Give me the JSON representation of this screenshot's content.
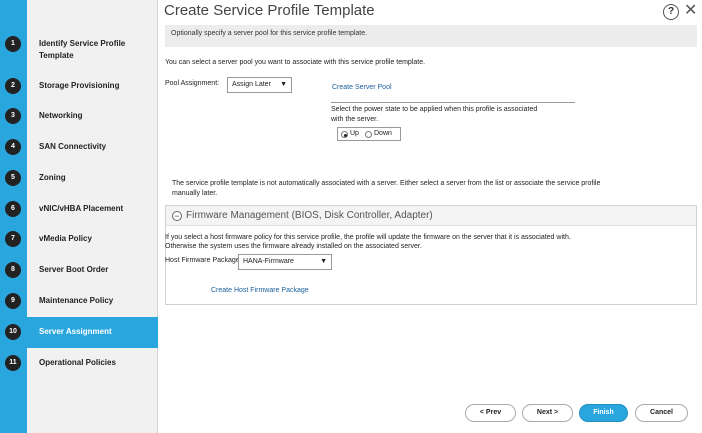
{
  "header": {
    "title": "Create Service Profile Template",
    "help_icon": "?",
    "close_icon": "✕"
  },
  "steps": [
    {
      "num": "1",
      "label": "Identify Service Profile",
      "label2": "Template",
      "active": false
    },
    {
      "num": "2",
      "label": "Storage Provisioning",
      "active": false
    },
    {
      "num": "3",
      "label": "Networking",
      "active": false
    },
    {
      "num": "4",
      "label": "SAN Connectivity",
      "active": false
    },
    {
      "num": "5",
      "label": "Zoning",
      "active": false
    },
    {
      "num": "6",
      "label": "vNIC/vHBA Placement",
      "active": false
    },
    {
      "num": "7",
      "label": "vMedia Policy",
      "active": false
    },
    {
      "num": "8",
      "label": "Server Boot Order",
      "active": false
    },
    {
      "num": "9",
      "label": "Maintenance Policy",
      "active": false
    },
    {
      "num": "10",
      "label": "Server Assignment",
      "active": true
    },
    {
      "num": "11",
      "label": "Operational Policies",
      "active": false
    }
  ],
  "main": {
    "banner": "Optionally specify a server pool for this service profile template.",
    "pool_intro": "You can select a server pool you want to associate with this service profile template.",
    "pool_label": "Pool Assignment:",
    "pool_value": "Assign Later",
    "create_pool_link": "Create Server Pool",
    "power_text_1": "Select the power state to be applied when this profile is associated",
    "power_text_2": "with the server.",
    "power_up": "Up",
    "power_down": "Down",
    "not_assoc_1": "The service profile template is not automatically associated with a server. Either select a server from the list or associate the service profile",
    "not_assoc_2": "manually later."
  },
  "firmware": {
    "collapse_icon": "−",
    "title": "Firmware Management (BIOS, Disk Controller, Adapter)",
    "desc_1": "If you select a host firmware policy for this service profile, the profile will update the firmware on the server that it is associated with.",
    "desc_2": "Otherwise the system uses the firmware already installed on the associated server.",
    "pkg_label": "Host Firmware Package:",
    "pkg_value": "HANA-Firmware",
    "create_link": "Create Host Firmware Package"
  },
  "footer": {
    "prev": "< Prev",
    "next": "Next >",
    "finish": "Finish",
    "cancel": "Cancel"
  },
  "colors": {
    "accent": "#2aa6df"
  }
}
